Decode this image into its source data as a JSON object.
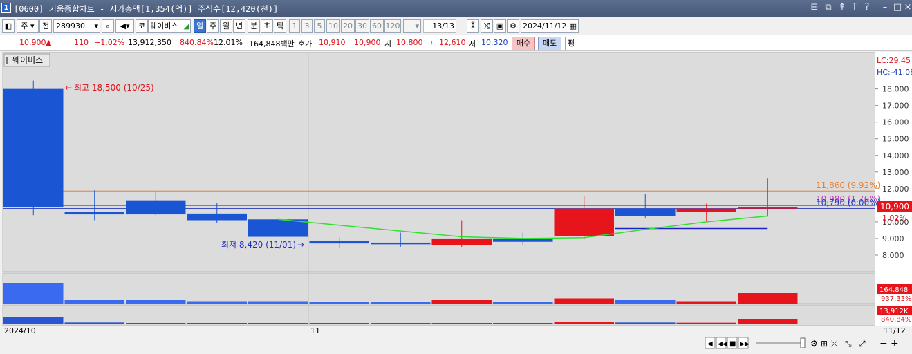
{
  "window": {
    "number": "1",
    "title": "[0600] 키움종합차트 - 시가총액[1,354(억)] 주식수[12,420(천)]"
  },
  "toolbar": {
    "period_unit": "주",
    "prev_label": "전",
    "code": "289930",
    "market_label": "코",
    "stock_name": "웨이비스",
    "intervals": [
      "일",
      "주",
      "월",
      "년",
      "분",
      "초",
      "틱"
    ],
    "selected_interval": "일",
    "minutes": [
      "1",
      "3",
      "5",
      "10",
      "20",
      "30",
      "60",
      "120"
    ],
    "count": "13/13",
    "date": "2024/11/12"
  },
  "quote": {
    "price": "10,900",
    "change": "110",
    "change_pct": "+1.02%",
    "volume": "13,912,350",
    "volume_ratio": "840.84%",
    "turnover": "12.01%",
    "amount": "164,848백만",
    "bid_label": "호가",
    "bid1": "10,910",
    "bid2": "10,900",
    "open_label": "시",
    "open": "10,800",
    "high_label": "고",
    "high": "12,610",
    "low_label": "저",
    "low": "10,320",
    "buy_label": "매수",
    "sell_label": "매도",
    "avg_label": "평"
  },
  "chart_panel": {
    "stock_label": "웨이비스",
    "max_note": "최고 18,500 (10/25)",
    "min_note": "최저 8,420 (11/01)",
    "line1_label": "11,860 (9.92%)",
    "line2_label": "10,980 (1.76%)",
    "line3_label": "10,790 (0.00%)",
    "lc_label": "LC:29.45",
    "hc_label": "HC:-41.08",
    "price_tag": "10,900",
    "pct_tag": "1.02%",
    "vol_tag": "164,848",
    "vol_pct_tag": "937.33%",
    "vol2_tag": "13,912K",
    "vol2_pct_tag": "840.84%",
    "x_labels": [
      "2024/10",
      "11",
      "11/12"
    ],
    "colors": {
      "up": "#e8141c",
      "down": "#1a55d4",
      "bg": "#dcdcdc"
    }
  },
  "chart_data": {
    "type": "candlestick",
    "y_ticks": [
      8000,
      9000,
      10000,
      11000,
      12000,
      13000,
      14000,
      15000,
      16000,
      17000,
      18000
    ],
    "y_tick_labels": [
      "8,000",
      "9,000",
      "10,000",
      "11,000",
      "12,000",
      "13,000",
      "14,000",
      "15,000",
      "16,000",
      "17,000",
      "18,000"
    ],
    "ylim": [
      7000,
      19400
    ],
    "candles": [
      {
        "open": 18000,
        "close": 10900,
        "high": 18500,
        "low": 10400
      },
      {
        "open": 10600,
        "close": 10450,
        "high": 11900,
        "low": 10100
      },
      {
        "open": 11300,
        "close": 10450,
        "high": 11850,
        "low": 10400
      },
      {
        "open": 10500,
        "close": 10100,
        "high": 11150,
        "low": 9950
      },
      {
        "open": 10150,
        "close": 9100,
        "high": 10150,
        "low": 9100
      },
      {
        "open": 8850,
        "close": 8700,
        "high": 9050,
        "low": 8420
      },
      {
        "open": 8750,
        "close": 8650,
        "high": 9350,
        "low": 8500
      },
      {
        "open": 8600,
        "close": 9000,
        "high": 10100,
        "low": 8500
      },
      {
        "open": 9000,
        "close": 8800,
        "high": 9350,
        "low": 8600
      },
      {
        "open": 9150,
        "close": 10800,
        "high": 11550,
        "low": 8950
      },
      {
        "open": 10800,
        "close": 10350,
        "high": 11700,
        "low": 10250
      },
      {
        "open": 10600,
        "close": 10800,
        "high": 11100,
        "low": 10050
      },
      {
        "open": 10800,
        "close": 10900,
        "high": 12610,
        "low": 10320
      }
    ],
    "volume": [
      6,
      1,
      1,
      0.5,
      0.5,
      0.3,
      0.3,
      1,
      0.3,
      1.5,
      1,
      0.5,
      3
    ],
    "amount": [
      3,
      0.8,
      0.6,
      0.5,
      0.4,
      0.3,
      0.3,
      0.5,
      0.3,
      1,
      0.8,
      0.7,
      2.4
    ],
    "ma_line": [
      null,
      null,
      null,
      null,
      10150,
      9800,
      9450,
      9100,
      9000,
      9050,
      9550,
      10000,
      10350
    ],
    "hlines": [
      11860,
      10980,
      10790
    ],
    "support": 9600
  }
}
